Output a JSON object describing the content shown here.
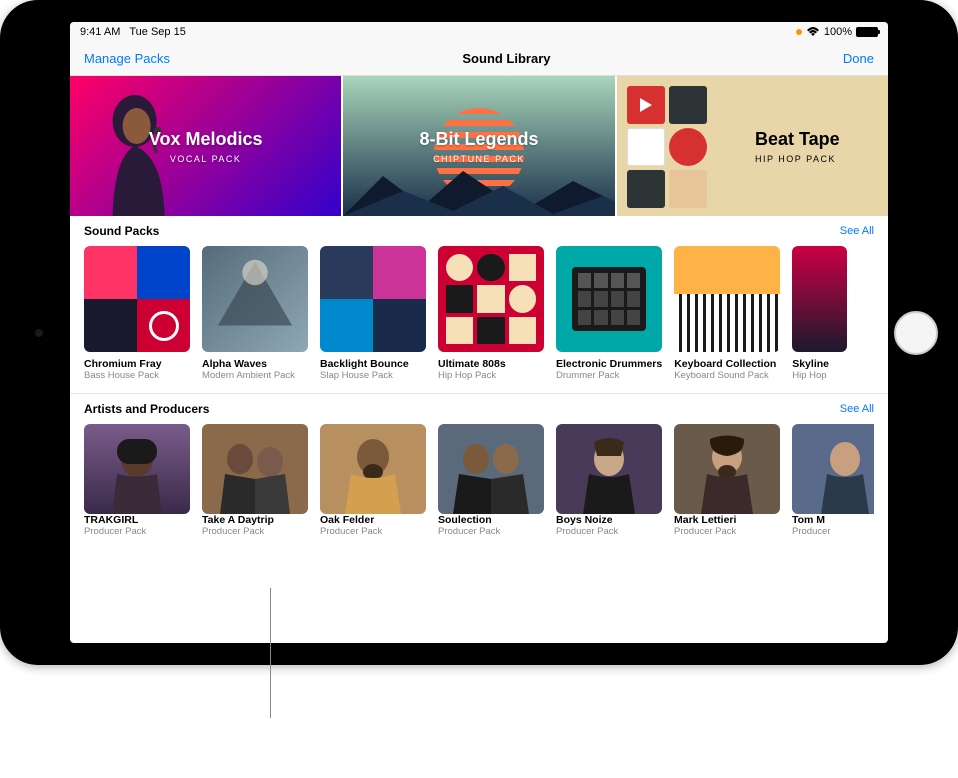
{
  "status": {
    "time": "9:41 AM",
    "date": "Tue Sep 15",
    "battery": "100%"
  },
  "nav": {
    "left": "Manage Packs",
    "title": "Sound Library",
    "right": "Done"
  },
  "heroes": [
    {
      "title": "Vox Melodics",
      "sub": "VOCAL PACK"
    },
    {
      "title": "8-Bit Legends",
      "sub": "CHIPTUNE PACK"
    },
    {
      "title": "Beat Tape",
      "sub": "HIP HOP PACK"
    }
  ],
  "sections": {
    "soundPacks": {
      "title": "Sound Packs",
      "seeAll": "See All",
      "items": [
        {
          "title": "Chromium Fray",
          "sub": "Bass House Pack"
        },
        {
          "title": "Alpha Waves",
          "sub": "Modern Ambient Pack"
        },
        {
          "title": "Backlight Bounce",
          "sub": "Slap House Pack"
        },
        {
          "title": "Ultimate 808s",
          "sub": "Hip Hop Pack"
        },
        {
          "title": "Electronic Drummers",
          "sub": "Drummer Pack"
        },
        {
          "title": "Keyboard Collection",
          "sub": "Keyboard Sound Pack"
        },
        {
          "title": "Skyline",
          "sub": "Hip Hop"
        }
      ]
    },
    "artists": {
      "title": "Artists and Producers",
      "seeAll": "See All",
      "items": [
        {
          "title": "TRAKGIRL",
          "sub": "Producer Pack"
        },
        {
          "title": "Take A Daytrip",
          "sub": "Producer Pack"
        },
        {
          "title": "Oak Felder",
          "sub": "Producer Pack"
        },
        {
          "title": "Soulection",
          "sub": "Producer Pack"
        },
        {
          "title": "Boys Noize",
          "sub": "Producer Pack"
        },
        {
          "title": "Mark Lettieri",
          "sub": "Producer Pack"
        },
        {
          "title": "Tom M",
          "sub": "Producer"
        }
      ]
    }
  }
}
